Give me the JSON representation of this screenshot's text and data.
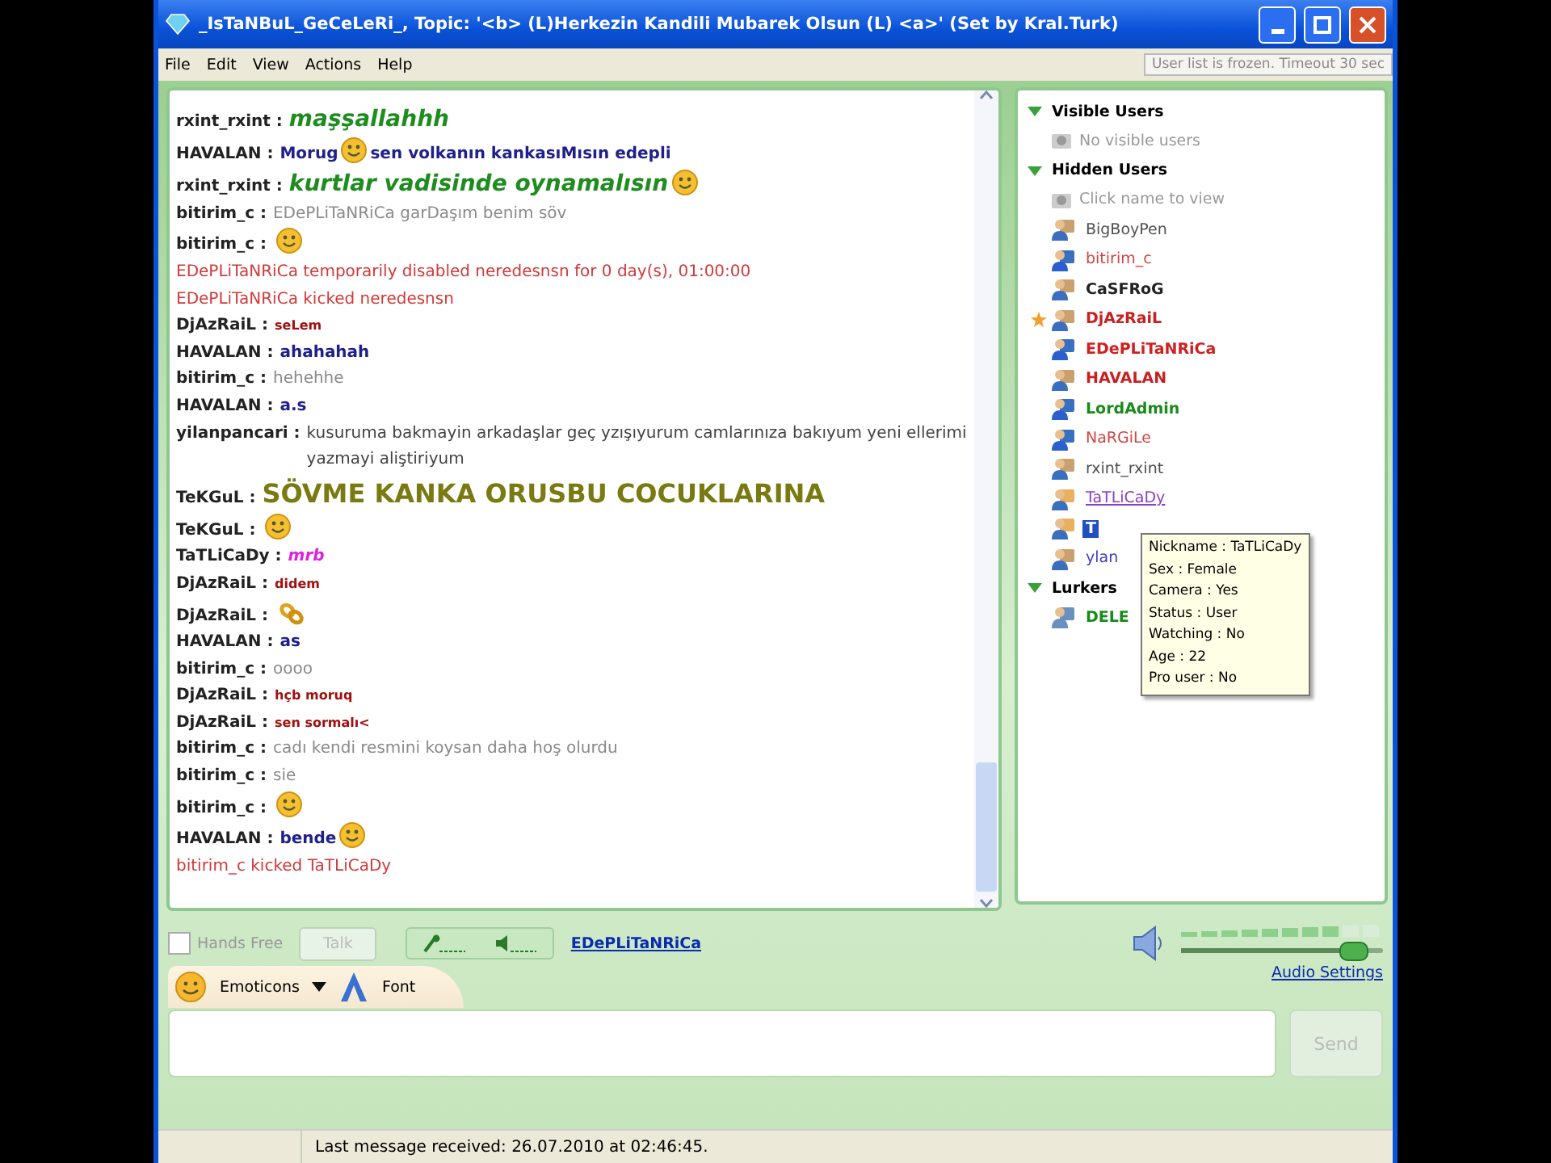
{
  "window": {
    "title": "_IsTaNBuL_GeCeLeRi_, Topic: '<b> (L)Herkezin Kandili Mubarek Olsun (L) <a>' (Set by Kral.Turk)"
  },
  "menu": [
    "File",
    "Edit",
    "View",
    "Actions",
    "Help"
  ],
  "notice": "User list is frozen. Timeout 30 sec",
  "chat": {
    "messages": [
      {
        "nick": "rxint_rxint :",
        "parts": [
          {
            "kind": "shout",
            "color": "#1e8c1e",
            "text": "maşşallahhh"
          }
        ]
      },
      {
        "nick": "HAVALAN :",
        "parts": [
          {
            "kind": "bold",
            "color": "#20208c",
            "text": "Morug"
          },
          {
            "kind": "smile"
          },
          {
            "kind": "bold",
            "color": "#20208c",
            "text": "sen volkanın kankasıMısın edepli"
          }
        ]
      },
      {
        "nick": "rxint_rxint :",
        "parts": [
          {
            "kind": "shout",
            "color": "#1e8c1e",
            "text": "kurtlar vadisinde oynamalısın"
          },
          {
            "kind": "smile"
          }
        ]
      },
      {
        "nick": "bitirim_c :",
        "parts": [
          {
            "kind": "plain",
            "color": "#8a8a8a",
            "text": "EDePLiTaNRiCa garDaşım benim söv"
          }
        ]
      },
      {
        "nick": "bitirim_c :",
        "parts": [
          {
            "kind": "smile"
          }
        ]
      },
      {
        "parts": [
          {
            "kind": "plain",
            "color": "#d03a3a",
            "text": "EDePLiTaNRiCa temporarily disabled neredesnsn for 0 day(s), 01:00:00"
          }
        ]
      },
      {
        "parts": [
          {
            "kind": "plain",
            "color": "#d03a3a",
            "text": "EDePLiTaNRiCa kicked neredesnsn"
          }
        ]
      },
      {
        "nick": "DjAzRaiL :",
        "parts": [
          {
            "kind": "tiny",
            "color": "#a01010",
            "text": "seLem"
          }
        ]
      },
      {
        "nick": "HAVALAN :",
        "parts": [
          {
            "kind": "bold",
            "color": "#20208c",
            "text": "ahahahah"
          }
        ]
      },
      {
        "nick": "bitirim_c :",
        "parts": [
          {
            "kind": "plain",
            "color": "#8a8a8a",
            "text": "hehehhe"
          }
        ]
      },
      {
        "nick": "HAVALAN :",
        "parts": [
          {
            "kind": "bold",
            "color": "#20208c",
            "text": "a.s"
          }
        ]
      },
      {
        "nick": "yilanpancari :",
        "parts": [
          {
            "kind": "plain",
            "color": "#444444",
            "text": "kusuruma bakmayin arkadaşlar geç yzışıyurum camlarınıza bakıyum yeni  ellerimi  yazmayi aliştiriyum"
          }
        ]
      },
      {
        "nick": "TeKGuL :",
        "parts": [
          {
            "kind": "headline",
            "color": "#7a7a12",
            "text": "SÖVME KANKA ORUSBU COCUKLARINA"
          }
        ]
      },
      {
        "nick": "TeKGuL :",
        "parts": [
          {
            "kind": "smile"
          }
        ]
      },
      {
        "nick": "TaTLiCaDy :",
        "parts": [
          {
            "kind": "italic",
            "color": "#e020e0",
            "text": "mrb"
          }
        ]
      },
      {
        "nick": "DjAzRaiL :",
        "parts": [
          {
            "kind": "tiny",
            "color": "#a01010",
            "text": "didem"
          }
        ]
      },
      {
        "nick": "DjAzRaiL :",
        "parts": [
          {
            "kind": "link"
          }
        ]
      },
      {
        "nick": "HAVALAN :",
        "parts": [
          {
            "kind": "bold",
            "color": "#20208c",
            "text": "as"
          }
        ]
      },
      {
        "nick": "bitirim_c :",
        "parts": [
          {
            "kind": "plain",
            "color": "#8a8a8a",
            "text": "oooo"
          }
        ]
      },
      {
        "nick": "DjAzRaiL :",
        "parts": [
          {
            "kind": "tiny",
            "color": "#a01010",
            "text": "hçb moruq"
          }
        ]
      },
      {
        "nick": "DjAzRaiL :",
        "parts": [
          {
            "kind": "tiny",
            "color": "#a01010",
            "text": "sen sormalı<"
          }
        ]
      },
      {
        "nick": "bitirim_c :",
        "parts": [
          {
            "kind": "plain",
            "color": "#8a8a8a",
            "text": "cadı kendi resmini koysan daha hoş olurdu"
          }
        ]
      },
      {
        "nick": "bitirim_c :",
        "parts": [
          {
            "kind": "plain",
            "color": "#8a8a8a",
            "text": "sie"
          }
        ]
      },
      {
        "nick": "bitirim_c :",
        "parts": [
          {
            "kind": "smile"
          }
        ]
      },
      {
        "nick": "HAVALAN :",
        "parts": [
          {
            "kind": "bold",
            "color": "#20208c",
            "text": "bende"
          },
          {
            "kind": "smile"
          }
        ]
      },
      {
        "parts": [
          {
            "kind": "plain",
            "color": "#d03a3a",
            "text": "bitirim_c kicked TaTLiCaDy"
          }
        ]
      }
    ]
  },
  "users": {
    "groups": [
      {
        "title": "Visible Users",
        "expanded": true,
        "note": "No visible users"
      },
      {
        "title": "Hidden Users",
        "expanded": true,
        "note": "Click name to view",
        "items": [
          {
            "name": "BigBoyPen",
            "color": "#505050",
            "bold": false,
            "kind": "user",
            "starred": false,
            "selected": false
          },
          {
            "name": "bitirim_c",
            "color": "#d04545",
            "bold": false,
            "kind": "admin",
            "starred": false,
            "selected": false
          },
          {
            "name": "CaSFRoG",
            "color": "#222222",
            "bold": true,
            "kind": "user",
            "starred": false,
            "selected": false
          },
          {
            "name": "DjAzRaiL",
            "color": "#c82020",
            "bold": true,
            "kind": "user",
            "starred": true,
            "selected": false
          },
          {
            "name": "EDePLiTaNRiCa",
            "color": "#d02020",
            "bold": true,
            "kind": "admin",
            "starred": false,
            "selected": false
          },
          {
            "name": "HAVALAN",
            "color": "#c82020",
            "bold": true,
            "kind": "user",
            "starred": false,
            "selected": false
          },
          {
            "name": "LordAdmin",
            "color": "#1a8a1a",
            "bold": true,
            "kind": "admin",
            "starred": false,
            "selected": false
          },
          {
            "name": "NaRGiLe",
            "color": "#d04545",
            "bold": false,
            "kind": "admin",
            "starred": false,
            "selected": false
          },
          {
            "name": "rxint_rxint",
            "color": "#505050",
            "bold": false,
            "kind": "user",
            "starred": false,
            "selected": false
          },
          {
            "name": "TaTLiCaDy",
            "color": "#8a40c8",
            "bold": false,
            "kind": "female",
            "starred": false,
            "selected": false
          },
          {
            "name": "T",
            "bold": true,
            "kind": "female",
            "starred": false,
            "selected": true
          },
          {
            "name": "ylan",
            "color": "#4040c0",
            "bold": false,
            "kind": "user",
            "starred": false,
            "selected": false
          }
        ]
      },
      {
        "title": "Lurkers",
        "expanded": true,
        "items": [
          {
            "name": "DELE",
            "color": "#1a8a1a",
            "bold": true,
            "kind": "lurker",
            "starred": false,
            "selected": false
          }
        ]
      }
    ],
    "tooltip": [
      "Nickname : TaTLiCaDy",
      "Sex : Female",
      "Camera : Yes",
      "Status : User",
      "Watching : No",
      "Age : 22",
      "Pro user : No"
    ]
  },
  "controls": {
    "hands_free": {
      "label": "Hands Free",
      "checked": false
    },
    "talk": {
      "label": "Talk",
      "disabled": true
    },
    "speaker": "EDePLiTaNRiCa",
    "volume": {
      "level": 0.85
    },
    "audio_settings": "Audio Settings"
  },
  "compose": {
    "tabs": [
      "Emoticons",
      "Font"
    ],
    "send": {
      "label": "Send",
      "disabled": true
    }
  },
  "status_bar": "Last message received: 26.07.2010 at 02:46:45."
}
